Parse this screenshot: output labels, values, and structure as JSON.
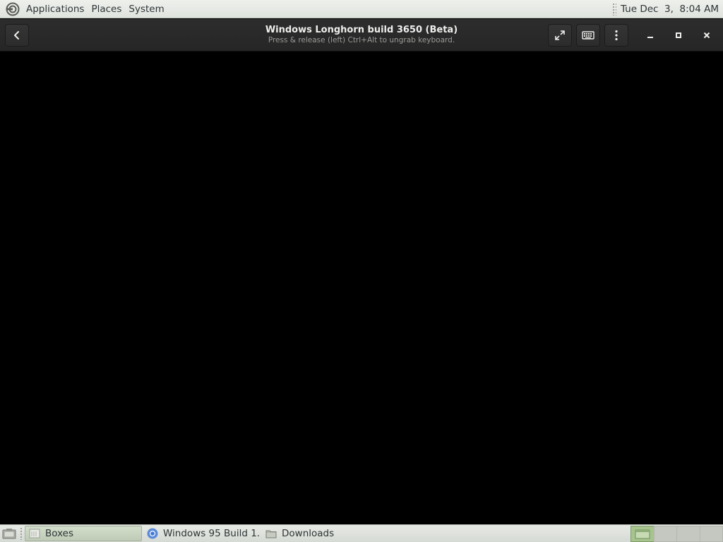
{
  "top_panel": {
    "menus": [
      "Applications",
      "Places",
      "System"
    ],
    "clock": "Tue Dec  3,  8:04 AM"
  },
  "headerbar": {
    "title": "Windows Longhorn build 3650 (Beta)",
    "subtitle": "Press & release (left) Ctrl+Alt to ungrab keyboard.",
    "icons": [
      "go-back-icon",
      "fullscreen-icon",
      "keyboard-icon",
      "menu-icon",
      "minimize-icon",
      "maximize-icon",
      "close-icon"
    ]
  },
  "taskbar": {
    "tasks": [
      {
        "label": "Boxes",
        "icon": "boxes-app-icon",
        "active": true
      },
      {
        "label": "Windows 95 Build 1...",
        "icon": "chromium-icon",
        "active": false
      },
      {
        "label": "Downloads",
        "icon": "folder-icon",
        "active": false
      }
    ],
    "workspace_count": 4,
    "active_workspace": 1
  },
  "colors": {
    "panel_bg": "#e3e6e1",
    "headerbar_bg": "#2b2b2b",
    "vm_bg": "#000000",
    "workspace_active": "#a7c48f"
  }
}
